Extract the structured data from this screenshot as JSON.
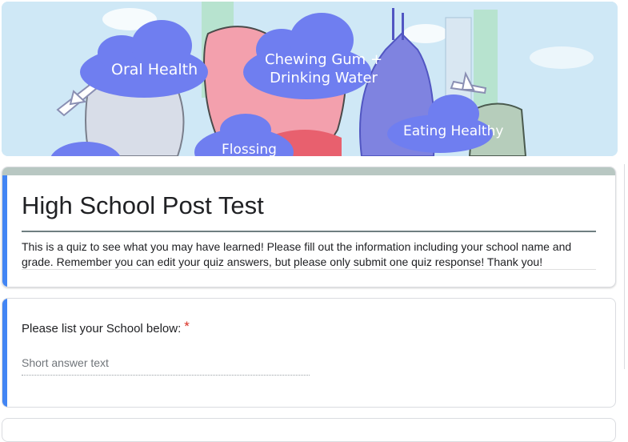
{
  "banner": {
    "clouds": [
      {
        "label": "Oral Health"
      },
      {
        "label_line1": "Chewing Gum +",
        "label_line2": "Drinking Water"
      },
      {
        "label": "Eating Healthy"
      },
      {
        "label": "Flossing"
      }
    ]
  },
  "form": {
    "title": "High School Post Test",
    "description": " This is a quiz to see what you may have learned! Please fill out the information including your school name and grade.  Remember you can edit your quiz answers, but please only submit one quiz response!  Thank you!"
  },
  "question": {
    "label": "Please list your School below:",
    "required_mark": "*",
    "placeholder": "Short answer text"
  },
  "colors": {
    "accent": "#4285f4",
    "header_strip": "#b8c7c2",
    "required": "#d93025",
    "cloud": "#6f7ef0"
  }
}
